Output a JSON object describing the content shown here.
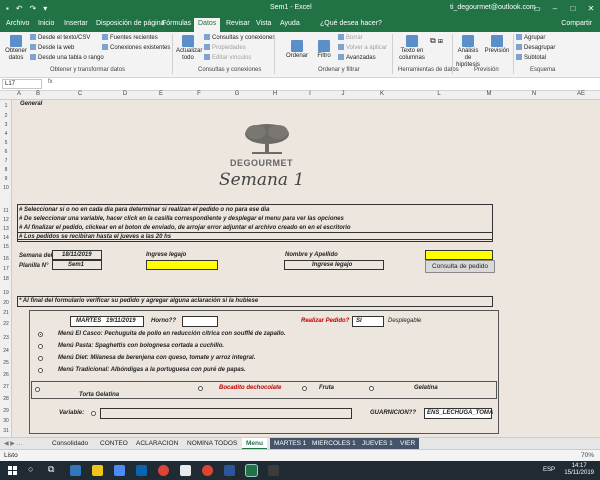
{
  "window": {
    "title": "Sem1 - Excel",
    "account": "ti_degourmet@outlook.com"
  },
  "tabs": [
    "Archivo",
    "Inicio",
    "Insertar",
    "Disposición de página",
    "Fórmulas",
    "Datos",
    "Revisar",
    "Vista",
    "Ayuda",
    "¿Qué desea hacer?"
  ],
  "share": "Compartir",
  "ribbon": {
    "obtener": "Obtener datos",
    "desde_texto": "Desde el texto/CSV",
    "desde_web": "Desde la web",
    "desde_tabla": "Desde una tabla o rango",
    "fuentes": "Fuentes recientes",
    "conexiones": "Conexiones existentes",
    "actualizar": "Actualizar todo",
    "consultas": "Consultas y conexiones",
    "propiedades": "Propiedades",
    "editar": "Editar vínculos",
    "ordenar": "Ordenar",
    "filtro": "Filtro",
    "borrar": "Borrar",
    "volver": "Volver a aplicar",
    "avanzadas": "Avanzadas",
    "texto_col": "Texto en columnas",
    "analisis": "Análisis de hipótesis",
    "prevision": "Previsión",
    "agrupar": "Agrupar",
    "desagrupar": "Desagrupar",
    "subtotal": "Subtotal",
    "g1": "Obtener y transformar datos",
    "g2": "Consultas y conexiones",
    "g3": "Ordenar y filtrar",
    "g4": "Herramientas de datos",
    "g5": "Previsión",
    "g6": "Esquema"
  },
  "formula": {
    "namebox": "L17",
    "content": "General"
  },
  "columns": [
    "A",
    "B",
    "C",
    "D",
    "E",
    "F",
    "G",
    "H",
    "I",
    "J",
    "K",
    "L",
    "M",
    "N",
    "AE"
  ],
  "rows": [
    "1",
    "2",
    "3",
    "4",
    "5",
    "6",
    "7",
    "8",
    "9",
    "10",
    "11",
    "12",
    "13",
    "14",
    "15",
    "16",
    "17",
    "18",
    "19",
    "20",
    "21",
    "22",
    "23",
    "24",
    "25",
    "26",
    "27",
    "28",
    "29",
    "30",
    "31"
  ],
  "sheet": {
    "general": "General",
    "brand": "DEGOURMET",
    "semana": "Semana 1",
    "instr1": "# Seleccionar si o no en cada dia para  determinar si realizan el pedido o no para ese dia",
    "instr2": "# De seleccionar una variable,  hacer click en la casilla correspondiente y desplegar el menu para ver las opciones",
    "instr3": "# Al finalizar el pedido, clickear en el boton de enviado, de arrojar error adjuntar el archivo creado en en el escritorio",
    "instr4": "# Los pedidos se recibiran hasta el jueves a las 20 hs",
    "semana_del": "Semana del",
    "semana_fecha": "18/11/2019",
    "planilla": "Planilla N°",
    "planilla_val": "Sem1",
    "ingrese_legajo": "Ingrese legajo",
    "nombre": "Nombre y Apellido",
    "ingrese_legajo2": "Ingrese legajo",
    "consulta": "Consulta de pedido",
    "aclaracion": "* Al final del formulario verificar su pedido y agregar alguna aclaración si la hubiese",
    "martes": "MARTES",
    "martes_fecha": "19/11/2019",
    "horno": "Horno??",
    "realizar": "Realizar Pedido?",
    "si": "SI",
    "desplegable": "Desplegable",
    "menu1": "Menú El Casco: Pechuguita de pollo en reducción cítrica con soufflé de zapallo.",
    "menu2": "Menú Pasta: Spaghettis con bolognesa cortada a cuchillo.",
    "menu3": "Menú Diet: Milanesa de berenjena con queso, tomate y arroz integral.",
    "menu4": "Menú Tradicional:  Albóndigas a la portuguesa con puré de papas.",
    "postre1": "Bocadito dechocolate",
    "postre2": "Fruta",
    "postre3": "Gelatina",
    "postre4": "Torta Gelatina",
    "variable": "Variable:",
    "guarnicion": "GUARNICION??",
    "guarnicion_val": "ENS_LECHUGA_TOMA"
  },
  "sheettabs": [
    "Consolidado",
    "CONTEO",
    "ACLARACION",
    "NOMINA TODOS",
    "Menu",
    "MARTES 1",
    "MIERCOLES 1",
    "JUEVES 1",
    "VIER"
  ],
  "status": {
    "left": "Listo",
    "zoom": "70%"
  },
  "tray": {
    "lang": "ESP",
    "time": "14:17",
    "date": "15/11/2019"
  }
}
